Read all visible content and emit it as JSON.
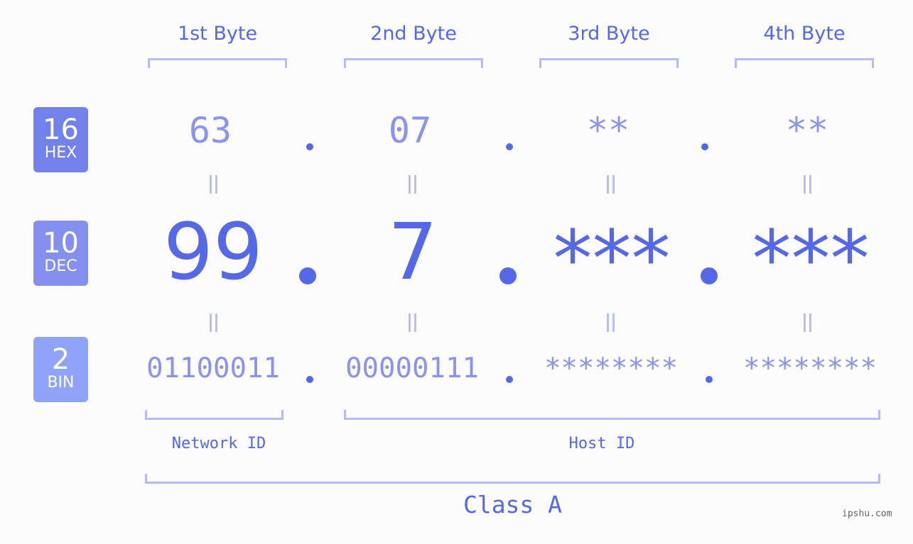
{
  "byte_headers": [
    "1st Byte",
    "2nd Byte",
    "3rd Byte",
    "4th Byte"
  ],
  "badges": [
    {
      "num": "16",
      "label": "HEX",
      "color": "#7282ea"
    },
    {
      "num": "10",
      "label": "DEC",
      "color": "#8390f0"
    },
    {
      "num": "2",
      "label": "BIN",
      "color": "#8fa4f8"
    }
  ],
  "hex": [
    "63",
    "07",
    "**",
    "**"
  ],
  "dec": [
    "99",
    "7",
    "***",
    "***"
  ],
  "bin": [
    "01100011",
    "00000111",
    "********",
    "********"
  ],
  "separator": ".",
  "network_id_label": "Network ID",
  "host_id_label": "Host ID",
  "class_label": "Class A",
  "watermark": "ipshu.com",
  "colors": {
    "accent": "#5468e8",
    "light": "#8a93ed",
    "bracket": "#b4bcf7"
  }
}
